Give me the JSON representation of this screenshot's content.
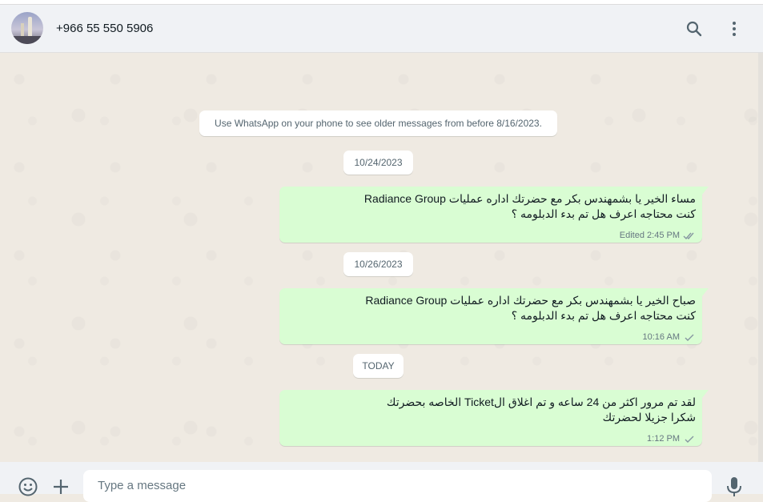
{
  "header": {
    "contact_name": "+966 55 550 5906",
    "search_icon": "search-icon",
    "menu_icon": "more-vertical-icon"
  },
  "chat": {
    "notice": "Use WhatsApp on your phone to see older messages from before 8/16/2023.",
    "date_1": "10/24/2023",
    "message_1": {
      "line_1": "مساء الخير يا بشمهندس بكر مع حضرتك اداره عمليات Radiance Group",
      "line_2": "كنت محتاجه اعرف هل تم بدء الدبلومه  ؟",
      "meta": "Edited 2:45 PM",
      "status": "read-double-tick"
    },
    "date_2": "10/26/2023",
    "message_2": {
      "line_1": "صباح الخير يا بشمهندس بكر مع حضرتك اداره عمليات Radiance Group",
      "line_2": "كنت محتاجه اعرف هل تم بدء الدبلومه ؟",
      "meta": "10:16 AM",
      "status": "sent-single-tick"
    },
    "date_3": "TODAY",
    "message_3": {
      "line_1": "لقد تم مرور اكثر من 24 ساعه و تم اغلاق الTicket الخاصه بحضرتك",
      "line_2": "شكرا جزيلا لحضرتك",
      "meta": "1:12 PM",
      "status": "sent-single-tick"
    }
  },
  "footer": {
    "emoji_icon": "emoji-icon",
    "attach_icon": "plus-icon",
    "input_placeholder": "Type a message",
    "mic_icon": "microphone-icon"
  },
  "colors": {
    "outgoing_bubble": "#d9fdd3",
    "chat_background": "#efeae2",
    "header_background": "#f0f2f5",
    "meta_text": "#667781",
    "icon": "#54656f"
  }
}
